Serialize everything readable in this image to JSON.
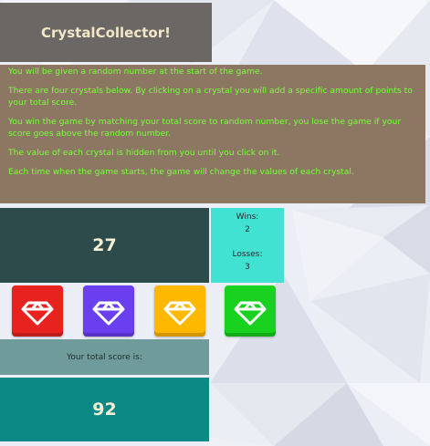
{
  "title": "CrystalCollector!",
  "instructions": [
    "You will be given a random number at the start of the game.",
    "There are four crystals below. By clicking on a crystal you will add a specific amount of points to your total score.",
    "You win the game by matching your total score to random number, you lose the game if your score goes above the random number.",
    "The value of each crystal is hidden from you until you click on it.",
    "Each time when the game starts, the game will change the values of each crystal."
  ],
  "target_number": "27",
  "record": {
    "wins_label": "Wins:",
    "wins": "2",
    "losses_label": "Losses:",
    "losses": "3"
  },
  "crystals": [
    {
      "color": "red",
      "fill": "#e8231f",
      "icon": "diamond-icon"
    },
    {
      "color": "purple",
      "fill": "#6a3ff0",
      "icon": "diamond-icon"
    },
    {
      "color": "yellow",
      "fill": "#ffb800",
      "icon": "diamond-icon"
    },
    {
      "color": "green",
      "fill": "#19d11f",
      "icon": "diamond-icon"
    }
  ],
  "score_label": "Your total score is:",
  "total_score": "92"
}
